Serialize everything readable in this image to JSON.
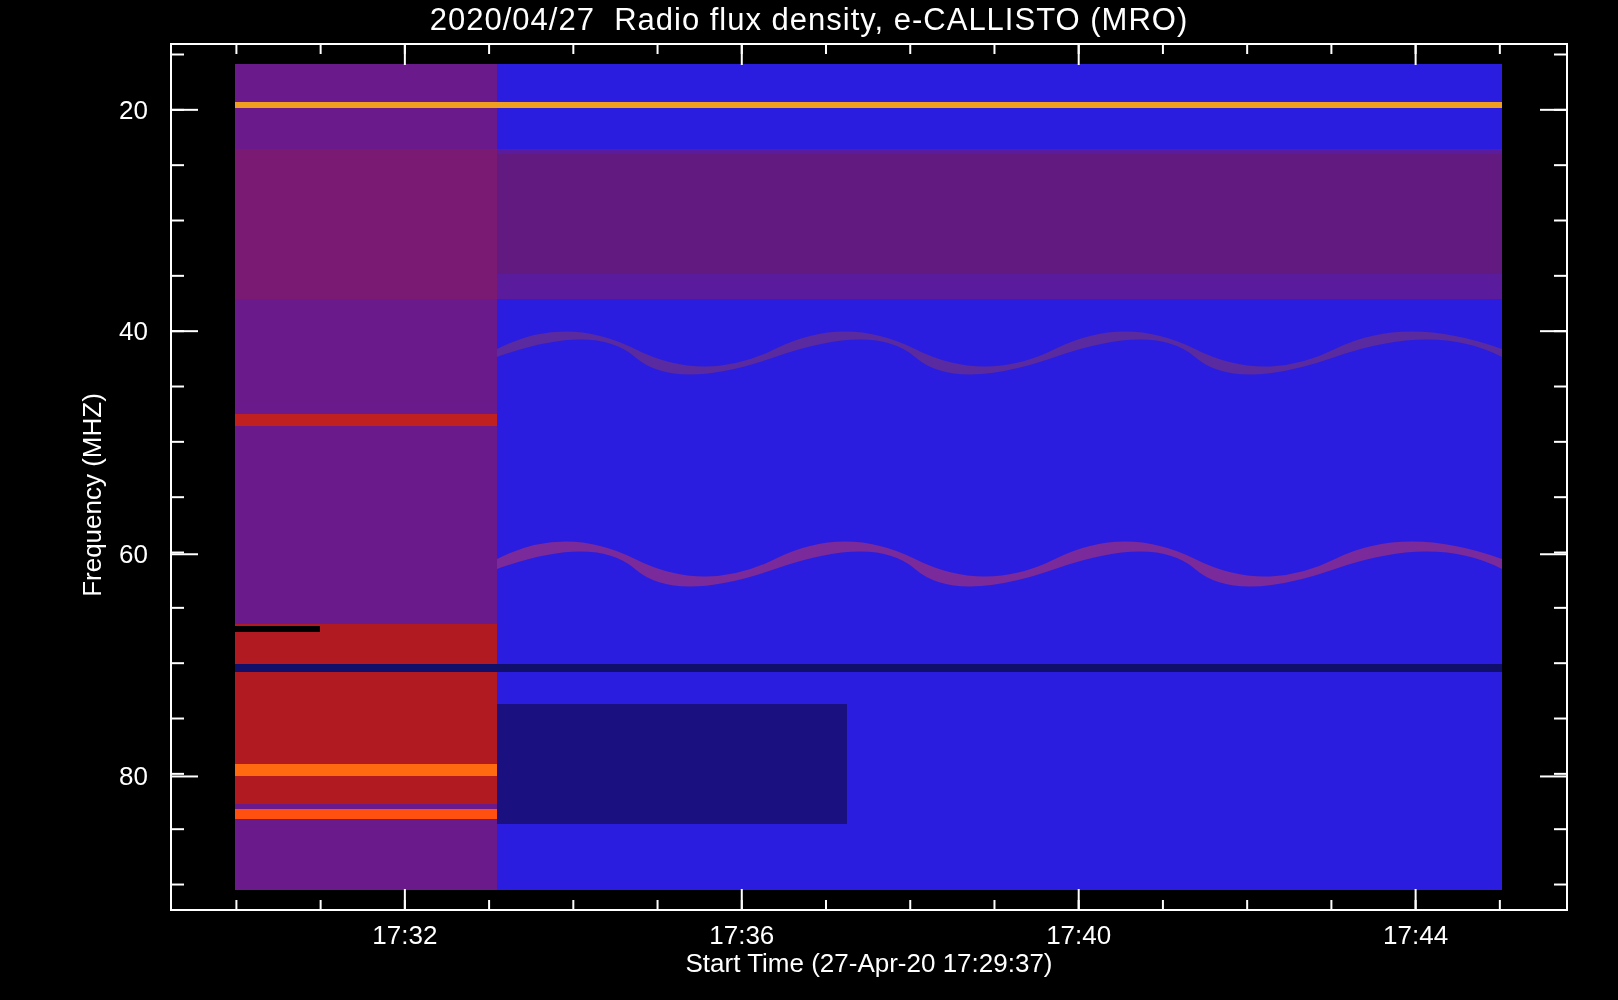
{
  "title": "2020/04/27  Radio flux density, e-CALLISTO (MRO)",
  "y_axis": {
    "label": "Frequency (MHZ)",
    "ticks": [
      "20",
      "40",
      "60",
      "80"
    ]
  },
  "x_axis": {
    "label": "Start Time (27-Apr-20 17:29:37)",
    "ticks": [
      "17:32",
      "17:36",
      "17:40",
      "17:44"
    ]
  }
}
